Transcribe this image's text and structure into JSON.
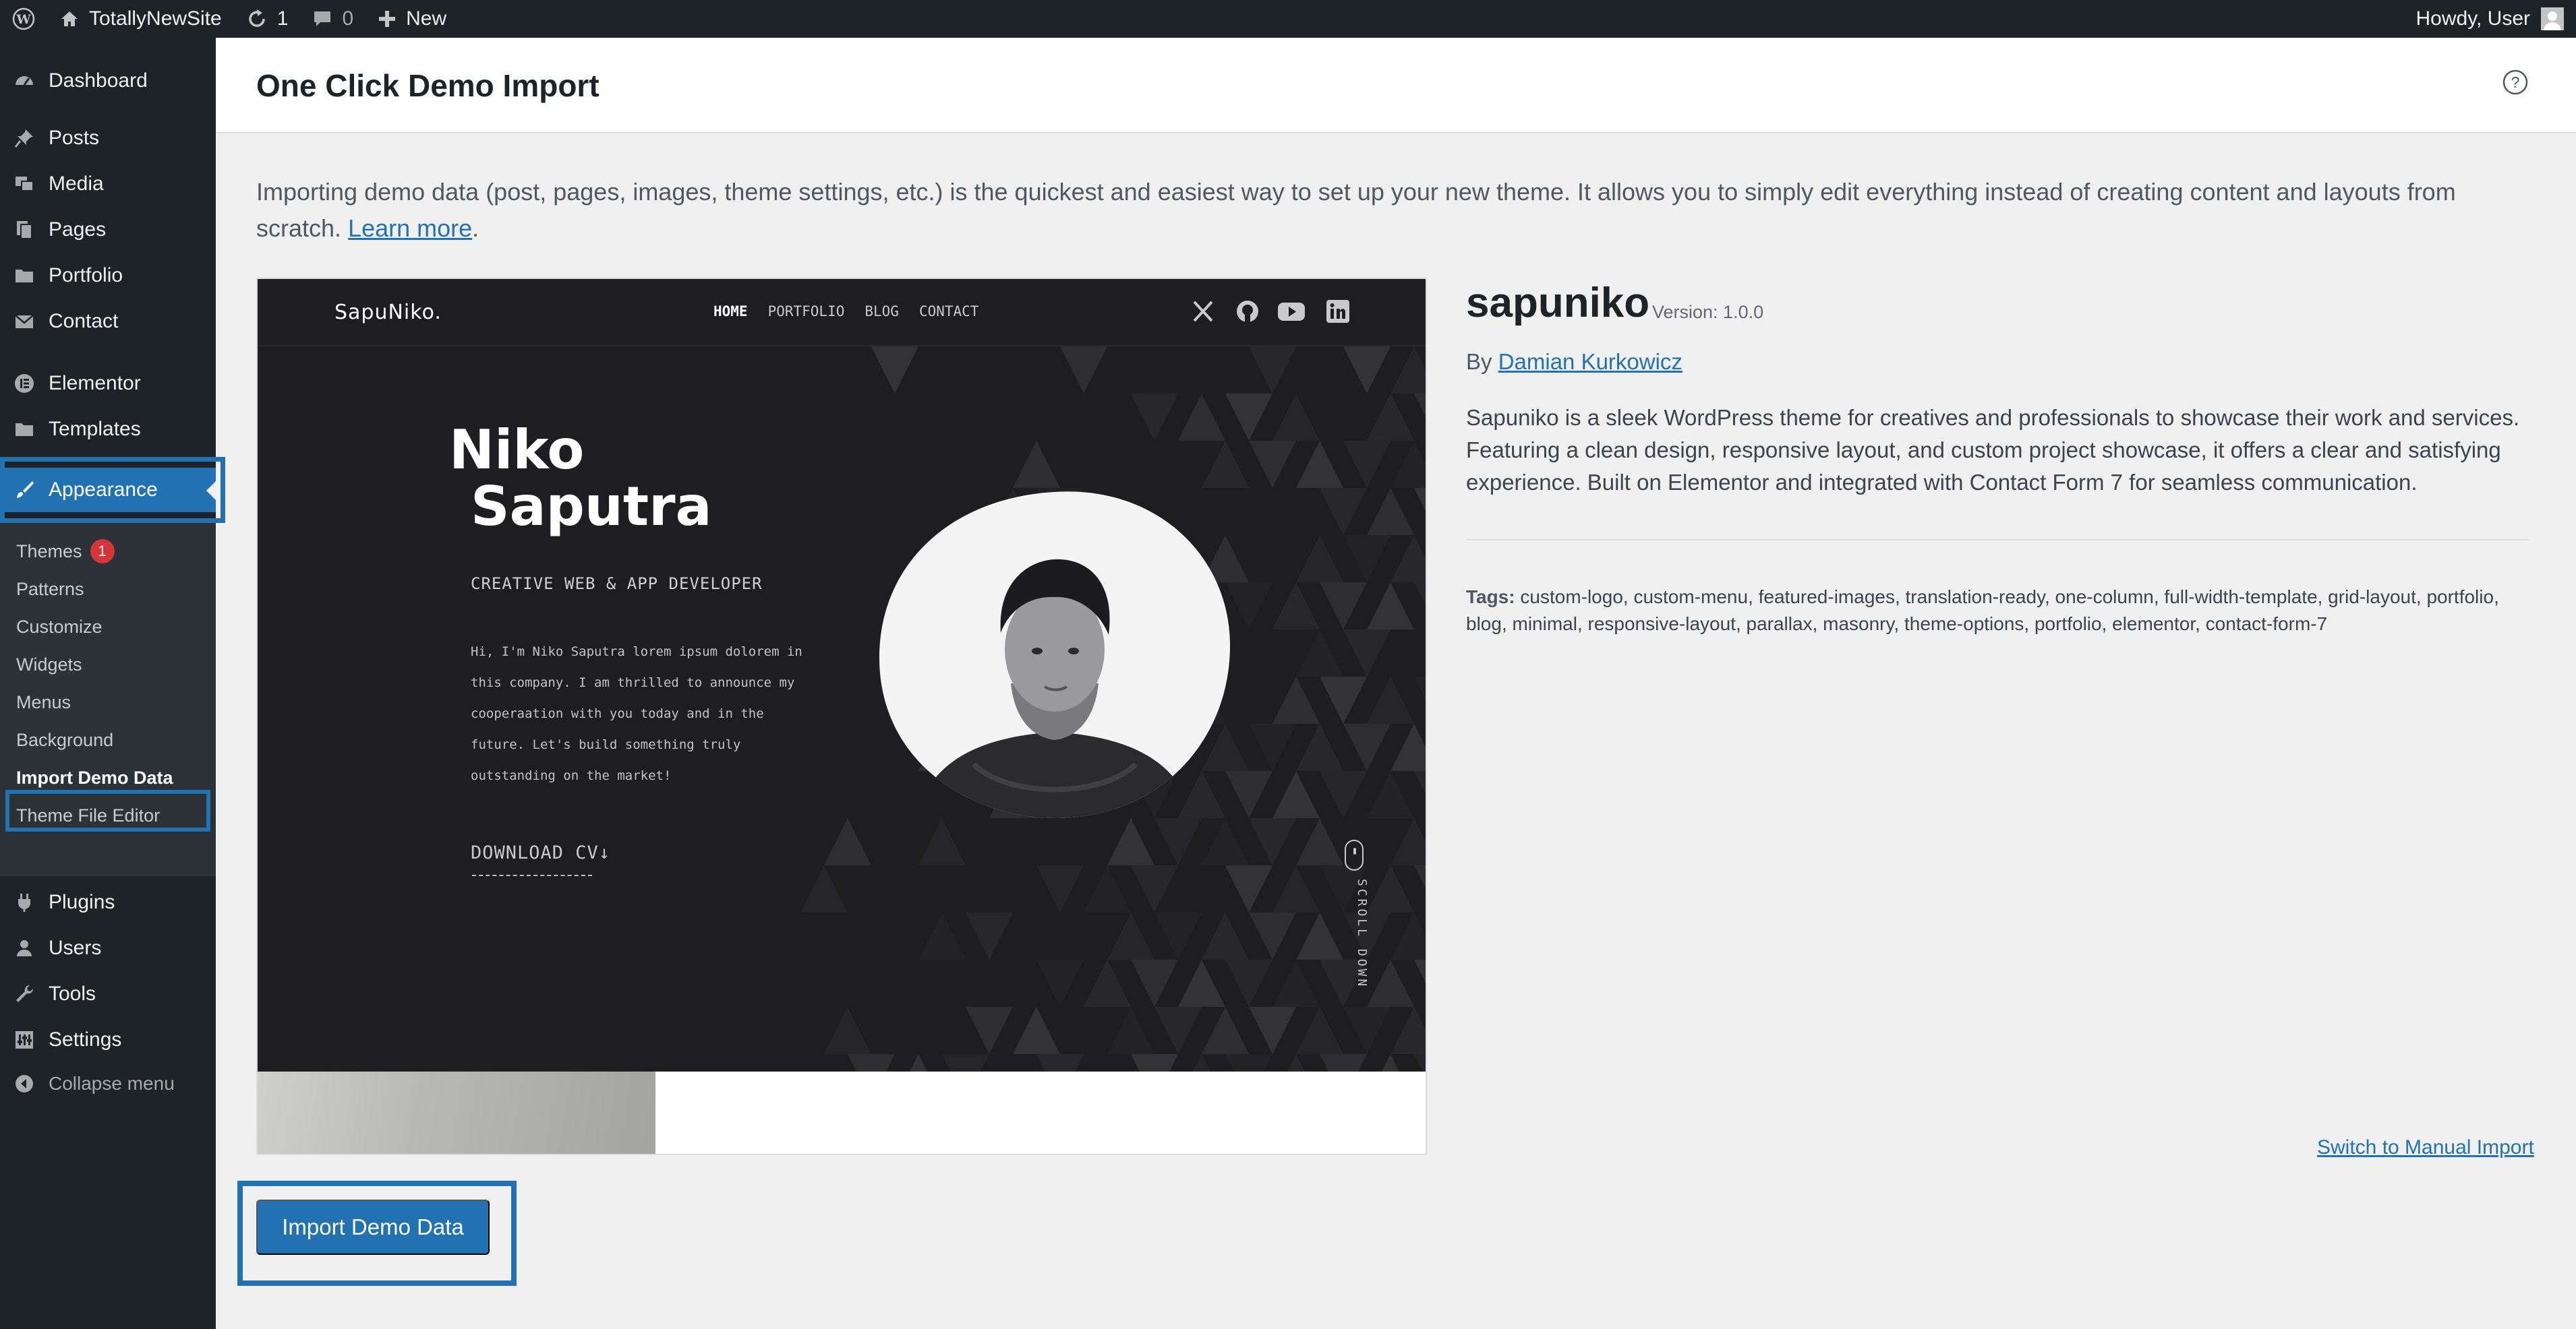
{
  "adminbar": {
    "site_name": "TotallyNewSite",
    "updates_count": "1",
    "comments_count": "0",
    "new_label": "New",
    "howdy": "Howdy, User"
  },
  "sidebar": {
    "items": [
      {
        "label": "Dashboard",
        "icon": "dashboard-icon"
      },
      {
        "label": "Posts",
        "icon": "pin-icon"
      },
      {
        "label": "Media",
        "icon": "media-icon"
      },
      {
        "label": "Pages",
        "icon": "pages-icon"
      },
      {
        "label": "Portfolio",
        "icon": "folder-icon"
      },
      {
        "label": "Contact",
        "icon": "mail-icon"
      },
      {
        "label": "Elementor",
        "icon": "elementor-icon"
      },
      {
        "label": "Templates",
        "icon": "folder-icon"
      },
      {
        "label": "Appearance",
        "icon": "brush-icon"
      },
      {
        "label": "Plugins",
        "icon": "plug-icon"
      },
      {
        "label": "Users",
        "icon": "user-icon"
      },
      {
        "label": "Tools",
        "icon": "wrench-icon"
      },
      {
        "label": "Settings",
        "icon": "settings-icon"
      },
      {
        "label": "Collapse menu",
        "icon": "collapse-icon"
      }
    ],
    "submenu": [
      {
        "label": "Themes",
        "badge": "1"
      },
      {
        "label": "Patterns"
      },
      {
        "label": "Customize"
      },
      {
        "label": "Widgets"
      },
      {
        "label": "Menus"
      },
      {
        "label": "Background"
      },
      {
        "label": "Import Demo Data"
      },
      {
        "label": "Theme File Editor"
      }
    ]
  },
  "page": {
    "title": "One Click Demo Import",
    "intro": "Importing demo data (post, pages, images, theme settings, etc.) is the quickest and easiest way to set up your new theme. It allows you to simply edit everything instead of creating content and layouts from scratch.",
    "learn_more": "Learn more",
    "intro_end": "."
  },
  "preview": {
    "logo": "SapuNiko.",
    "nav": [
      "HOME",
      "PORTFOLIO",
      "BLOG",
      "CONTACT"
    ],
    "name_line1": "Niko",
    "name_line2": "Saputra",
    "role": "CREATIVE WEB & APP DEVELOPER",
    "bio": "Hi, I'm Niko Saputra lorem ipsum dolorem in this company. I am thrilled to announce my cooperaation with you today and in the future. Let's build something truly outstanding on the market!",
    "cv": "DOWNLOAD CV",
    "cv_arrow": "↓",
    "scroll": "SCROLL DOWN"
  },
  "theme": {
    "name": "sapuniko",
    "version": "Version: 1.0.0",
    "by_prefix": "By",
    "author": "Damian Kurkowicz",
    "description": "Sapuniko is a sleek WordPress theme for creatives and professionals to showcase their work and services. Featuring a clean design, responsive layout, and custom project showcase, it offers a clear and satisfying experience. Built on Elementor and integrated with Contact Form 7 for seamless communication.",
    "tags_label": "Tags:",
    "tags": "custom-logo, custom-menu, featured-images, translation-ready, one-column, full-width-template, grid-layout, portfolio, blog, minimal, responsive-layout, parallax, masonry, theme-options, portfolio, elementor, contact-form-7",
    "switch_link": "Switch to Manual Import",
    "import_button": "Import Demo Data"
  },
  "colors": {
    "admin_dark": "#1d2327",
    "accent_blue": "#2271b1",
    "badge_red": "#d63638"
  }
}
